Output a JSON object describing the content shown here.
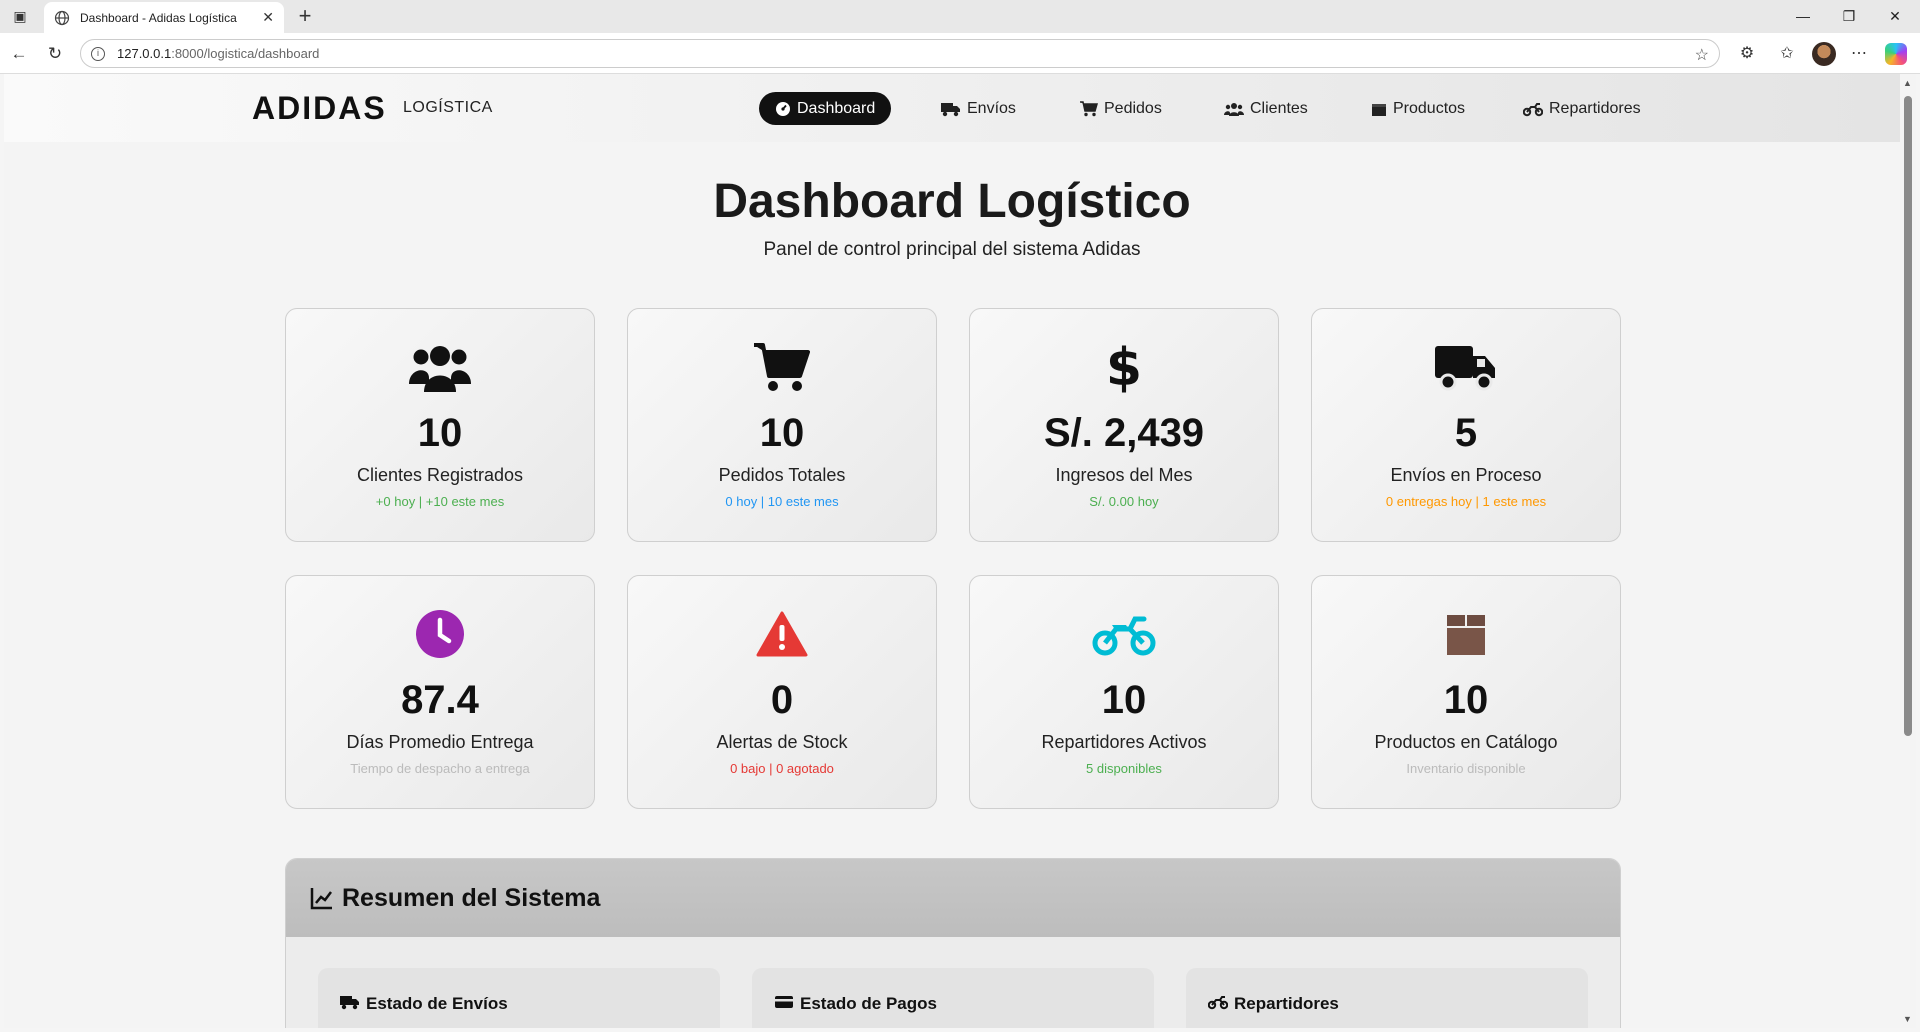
{
  "browser": {
    "tab_title": "Dashboard - Adidas Logística",
    "url_host": "127.0.0.1",
    "url_rest": ":8000/logistica/dashboard"
  },
  "nav": {
    "brand": "ADIDAS",
    "brand_sub": "LOGÍSTICA",
    "links": [
      {
        "label": "Dashboard",
        "icon": "gauge-icon",
        "active": true
      },
      {
        "label": "Envíos",
        "icon": "truck-icon"
      },
      {
        "label": "Pedidos",
        "icon": "cart-icon"
      },
      {
        "label": "Clientes",
        "icon": "users-icon"
      },
      {
        "label": "Productos",
        "icon": "box-icon"
      },
      {
        "label": "Repartidores",
        "icon": "motorcycle-icon"
      }
    ]
  },
  "header": {
    "title": "Dashboard Logístico",
    "subtitle": "Panel de control principal del sistema Adidas"
  },
  "cards": [
    {
      "value": "10",
      "label": "Clientes Registrados",
      "detail": "+0 hoy | +10 este mes",
      "icon": "users-icon",
      "color": "#4caf50"
    },
    {
      "value": "10",
      "label": "Pedidos Totales",
      "detail": "0 hoy | 10 este mes",
      "icon": "cart-icon",
      "color": "#2196f3"
    },
    {
      "value": "S/. 2,439",
      "label": "Ingresos del Mes",
      "detail": "S/. 0.00 hoy",
      "icon": "dollar-icon",
      "color": "#4caf50"
    },
    {
      "value": "5",
      "label": "Envíos en Proceso",
      "detail": "0 entregas hoy | 1 este mes",
      "icon": "truck-icon",
      "color": "#ff9800"
    },
    {
      "value": "87.4",
      "label": "Días Promedio Entrega",
      "detail": "Tiempo de despacho a entrega",
      "icon": "clock-icon",
      "color": "#bbbbbb"
    },
    {
      "value": "0",
      "label": "Alertas de Stock",
      "detail": "0 bajo | 0 agotado",
      "icon": "warning-icon",
      "color": "#e53935"
    },
    {
      "value": "10",
      "label": "Repartidores Activos",
      "detail": "5 disponibles",
      "icon": "motorcycle-icon",
      "color": "#4caf50"
    },
    {
      "value": "10",
      "label": "Productos en Catálogo",
      "detail": "Inventario disponible",
      "icon": "box-icon",
      "color": "#bbbbbb"
    }
  ],
  "icon_colors": {
    "clock": "#9c27b0",
    "warning": "#e53935",
    "motorcycle": "#00bcd4",
    "box": "#795548"
  },
  "summary": {
    "title": "Resumen del Sistema",
    "sections": [
      {
        "title": "Estado de Envíos"
      },
      {
        "title": "Estado de Pagos"
      },
      {
        "title": "Repartidores"
      }
    ]
  }
}
